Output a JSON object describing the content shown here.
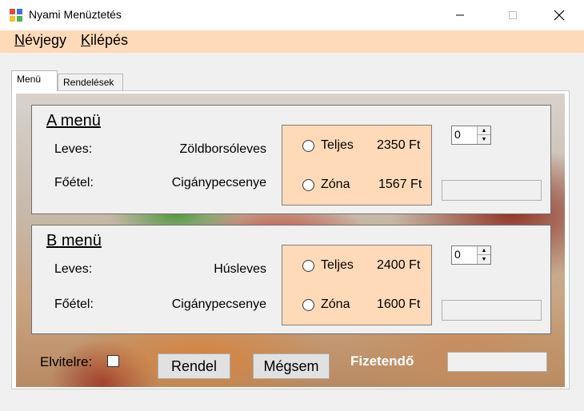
{
  "window": {
    "title": "Nyami Menüztetés",
    "controls": [
      "minimize-icon",
      "maximize-icon",
      "close-icon"
    ]
  },
  "menubar": {
    "items": [
      {
        "label": "Névjegy"
      },
      {
        "label": "Kilépés"
      }
    ]
  },
  "tabs": [
    {
      "label": "Menü",
      "active": true
    },
    {
      "label": "Rendelések",
      "active": false
    }
  ],
  "menus": [
    {
      "title": "A menü",
      "leves_label": "Leves:",
      "leves": "Zöldborsóleves",
      "foetel_label": "Főétel:",
      "foetel": "Cigánypecsenye",
      "options": [
        {
          "label": "Teljes",
          "price": "2350 Ft"
        },
        {
          "label": "Zóna",
          "price": "1567 Ft"
        }
      ],
      "quantity": "0",
      "subtotal": ""
    },
    {
      "title": "B menü",
      "leves_label": "Leves:",
      "leves": "Húsleves",
      "foetel_label": "Főétel:",
      "foetel": "Cigánypecsenye",
      "options": [
        {
          "label": "Teljes",
          "price": "2400 Ft"
        },
        {
          "label": "Zóna",
          "price": "1600 Ft"
        }
      ],
      "quantity": "0",
      "subtotal": ""
    }
  ],
  "footer": {
    "elvitelre_label": "Elvitelre:",
    "elvitelre_checked": false,
    "order_button": "Rendel",
    "cancel_button": "Mégsem",
    "total_label": "Fizetendő",
    "total_value": ""
  },
  "colors": {
    "menubar": "#ffdab9",
    "option_box": "#ffdab9",
    "window_bg": "#f0f0f0"
  }
}
